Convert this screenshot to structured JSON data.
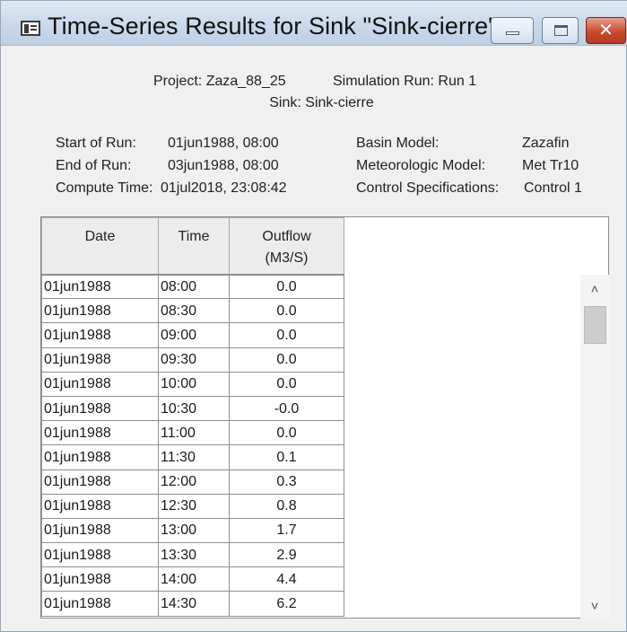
{
  "window": {
    "title": "Time-Series Results for Sink \"Sink-cierre\"",
    "controls": {
      "minimize": "minimize",
      "maximize": "maximize",
      "close": "✕"
    }
  },
  "header": {
    "project": "Project: Zaza_88_25",
    "simulation_run": "Simulation Run: Run 1",
    "sink": "Sink: Sink-cierre"
  },
  "run_info": {
    "start_label": "Start of Run:",
    "start_value": "01jun1988, 08:00",
    "end_label": "End of Run:",
    "end_value": "03jun1988, 08:00",
    "compute_label": "Compute Time:",
    "compute_value": "01jul2018, 23:08:42",
    "basin_label": "Basin Model:",
    "basin_value": "Zazafin",
    "met_label": "Meteorologic Model:",
    "met_value": "Met Tr10",
    "control_label": "Control Specifications:",
    "control_value": "Control 1"
  },
  "table": {
    "columns": [
      "Date",
      "Time",
      "Outflow",
      "(M3/S)"
    ],
    "rows": [
      [
        "01jun1988",
        "08:00",
        "0.0"
      ],
      [
        "01jun1988",
        "08:30",
        "0.0"
      ],
      [
        "01jun1988",
        "09:00",
        "0.0"
      ],
      [
        "01jun1988",
        "09:30",
        "0.0"
      ],
      [
        "01jun1988",
        "10:00",
        "0.0"
      ],
      [
        "01jun1988",
        "10:30",
        "-0.0"
      ],
      [
        "01jun1988",
        "11:00",
        "0.0"
      ],
      [
        "01jun1988",
        "11:30",
        "0.1"
      ],
      [
        "01jun1988",
        "12:00",
        "0.3"
      ],
      [
        "01jun1988",
        "12:30",
        "0.8"
      ],
      [
        "01jun1988",
        "13:00",
        "1.7"
      ],
      [
        "01jun1988",
        "13:30",
        "2.9"
      ],
      [
        "01jun1988",
        "14:00",
        "4.4"
      ],
      [
        "01jun1988",
        "14:30",
        "6.2"
      ]
    ]
  },
  "scrollbar": {
    "up_icon": "chevron-up-icon",
    "down_icon": "chevron-down-icon"
  }
}
